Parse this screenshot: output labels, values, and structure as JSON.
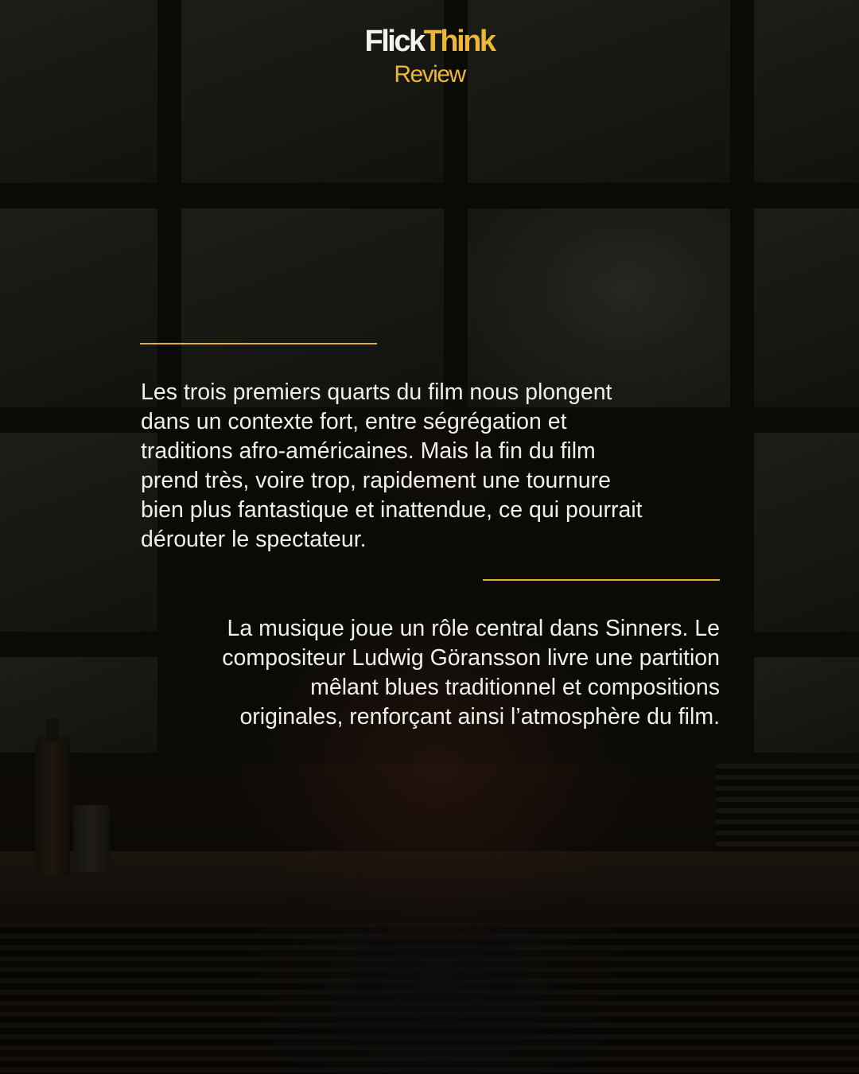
{
  "header": {
    "brand_part1": "Flick",
    "brand_part2": "Think",
    "subtitle": "Review"
  },
  "review": {
    "paragraph_1_lines": [
      "Les trois premiers quarts du film nous plongent",
      "dans un contexte fort, entre ségrégation et",
      "traditions afro-américaines. Mais la fin du film",
      "prend très, voire trop, rapidement une tournure",
      "bien plus fantastique et inattendue, ce qui pourrait",
      "dérouter le spectateur."
    ],
    "paragraph_2_lines": [
      "La musique joue un rôle central dans Sinners. Le",
      "compositeur Ludwig Göransson livre une partition",
      "mêlant blues traditionnel et compositions",
      "originales, renforçant ainsi l’atmosphère du film."
    ]
  },
  "colors": {
    "accent": "#efb537",
    "text": "#f1efe9",
    "background": "#1a1a14"
  }
}
